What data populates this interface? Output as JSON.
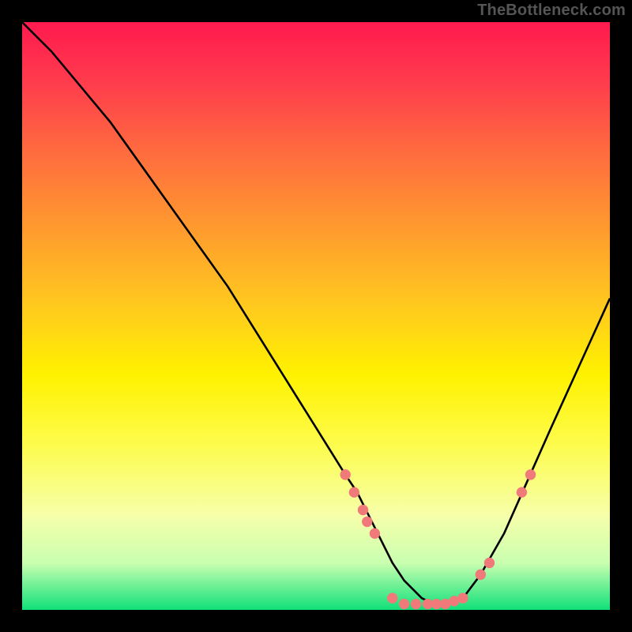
{
  "attribution": "TheBottleneck.com",
  "chart_data": {
    "type": "line",
    "xlabel": "",
    "ylabel": "",
    "xlim": [
      0,
      100
    ],
    "ylim": [
      0,
      100
    ],
    "title": "",
    "series": [
      {
        "name": "curve",
        "x": [
          0,
          5,
          10,
          15,
          20,
          25,
          30,
          35,
          40,
          45,
          50,
          55,
          57,
          60,
          63,
          65,
          68,
          70,
          72,
          75,
          78,
          82,
          86,
          90,
          95,
          100
        ],
        "y": [
          100,
          95,
          89,
          83,
          76,
          69,
          62,
          55,
          47,
          39,
          31,
          23,
          20,
          14,
          8,
          5,
          2,
          1,
          1,
          2,
          6,
          13,
          22,
          31,
          42,
          53
        ]
      }
    ],
    "markers": {
      "name": "dots",
      "color": "#f07a7a",
      "points": [
        {
          "x": 55,
          "y": 23
        },
        {
          "x": 56.5,
          "y": 20
        },
        {
          "x": 58,
          "y": 17
        },
        {
          "x": 58.7,
          "y": 15
        },
        {
          "x": 60,
          "y": 13
        },
        {
          "x": 63,
          "y": 2
        },
        {
          "x": 65,
          "y": 1
        },
        {
          "x": 67,
          "y": 1
        },
        {
          "x": 69,
          "y": 1
        },
        {
          "x": 70.5,
          "y": 1
        },
        {
          "x": 72,
          "y": 1
        },
        {
          "x": 73.5,
          "y": 1.5
        },
        {
          "x": 75,
          "y": 2
        },
        {
          "x": 78,
          "y": 6
        },
        {
          "x": 79.5,
          "y": 8
        },
        {
          "x": 85,
          "y": 20
        },
        {
          "x": 86.5,
          "y": 23
        }
      ]
    }
  }
}
